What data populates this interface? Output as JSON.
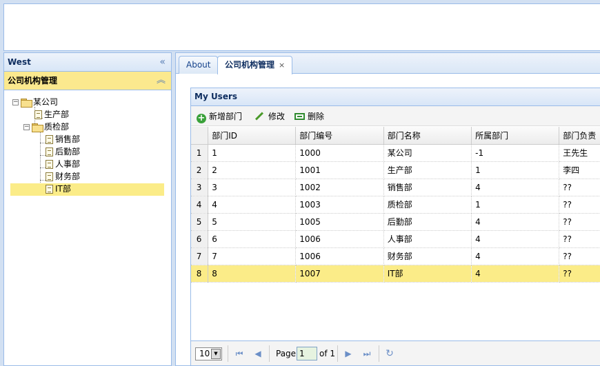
{
  "west": {
    "title": "West",
    "collapse_icon": "double-chevron-left-icon",
    "accordion": {
      "title": "公司机构管理",
      "toggle_icon": "double-chevron-up-icon"
    }
  },
  "tree": {
    "root": "某公司",
    "n1": "生产部",
    "n2": "质检部",
    "n3": "销售部",
    "n4": "后勤部",
    "n5": "人事部",
    "n6": "财务部",
    "n7": "IT部",
    "selected": "IT部"
  },
  "tabs": [
    {
      "label": "About"
    },
    {
      "label": "公司机构管理",
      "close": "×"
    }
  ],
  "grid": {
    "title": "My Users",
    "toolbar": {
      "add": "新增部门",
      "edit": "修改",
      "delete": "删除"
    },
    "columns": [
      "部门ID",
      "部门编号",
      "部门名称",
      "所属部门",
      "部门负责"
    ],
    "rows": [
      [
        "1",
        "1",
        "1000",
        "某公司",
        "-1",
        "王先生"
      ],
      [
        "2",
        "2",
        "1001",
        "生产部",
        "1",
        "李四"
      ],
      [
        "3",
        "3",
        "1002",
        "销售部",
        "4",
        "??"
      ],
      [
        "4",
        "4",
        "1003",
        "质检部",
        "1",
        "??"
      ],
      [
        "5",
        "5",
        "1005",
        "后勤部",
        "4",
        "??"
      ],
      [
        "6",
        "6",
        "1006",
        "人事部",
        "4",
        "??"
      ],
      [
        "7",
        "7",
        "1006",
        "财务部",
        "4",
        "??"
      ],
      [
        "8",
        "8",
        "1007",
        "IT部",
        "4",
        "??"
      ]
    ],
    "selected_row": 8
  },
  "pager": {
    "page_size": "10",
    "page_label": "Page",
    "page_value": "1",
    "of_label": "of 1"
  },
  "colors": {
    "selection": "#fbec88",
    "panel_border": "#99bbe8",
    "header_text": "#0e2d5f"
  }
}
